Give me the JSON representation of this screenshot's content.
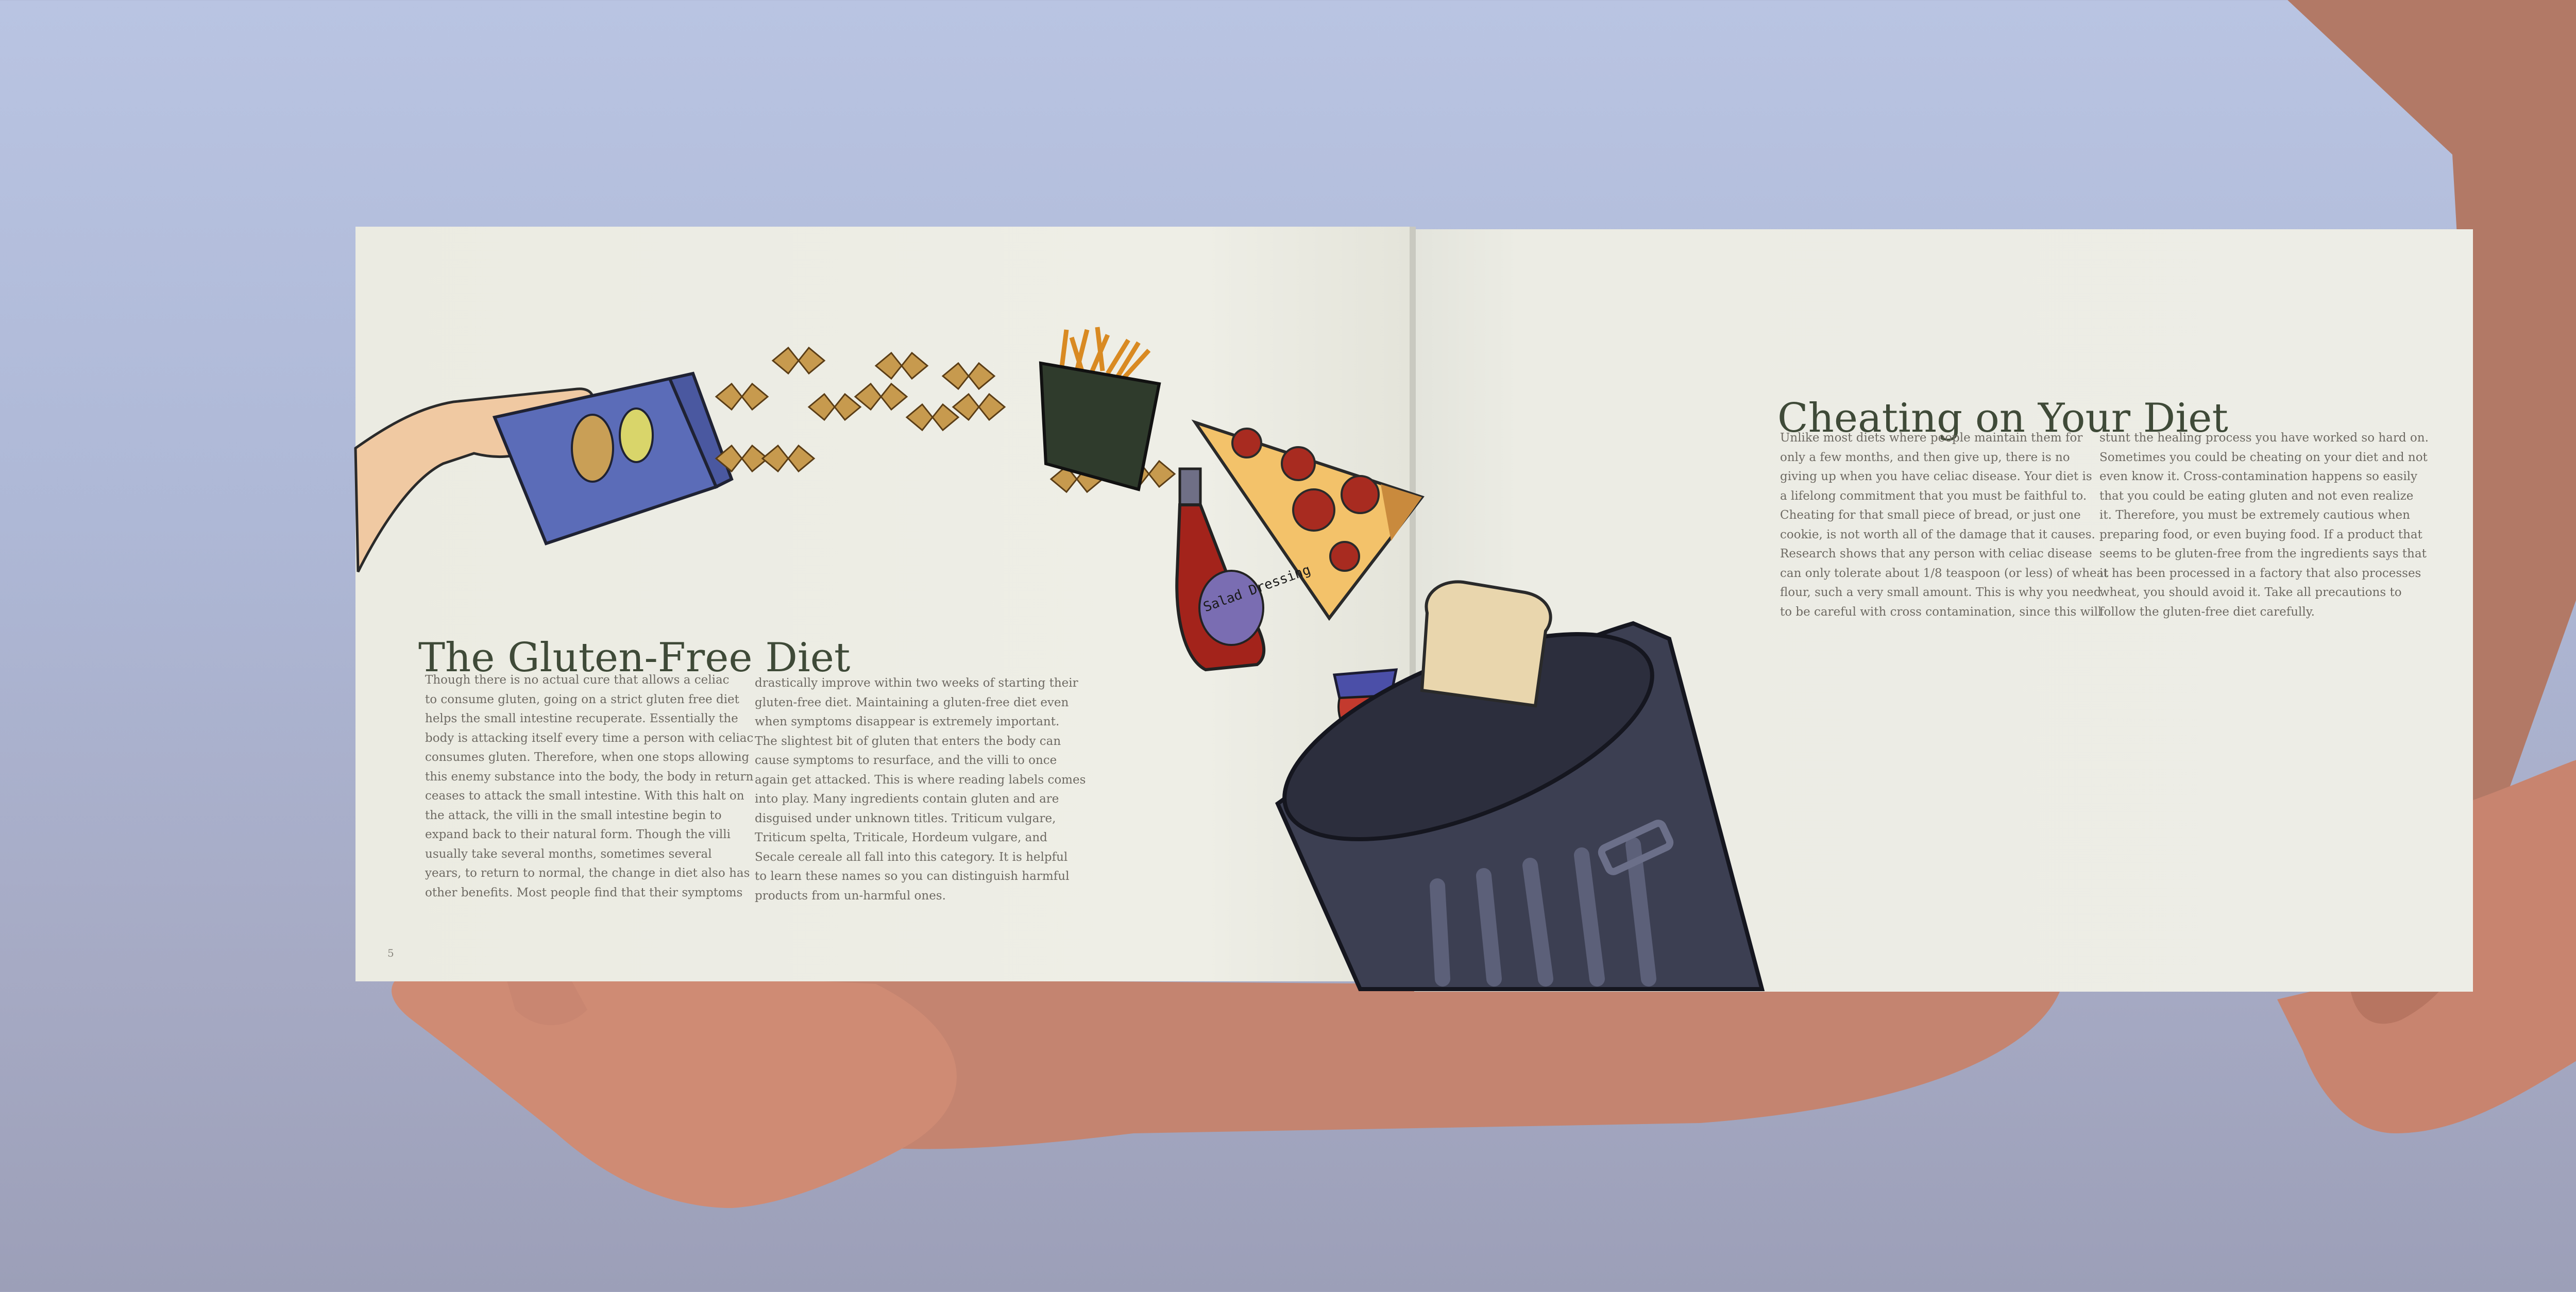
{
  "left_page": {
    "title": "The Gluten-Free Diet",
    "column1": [
      "Though there is no actual cure that allows a celiac",
      "to consume gluten, going on a strict gluten free diet",
      "helps the small intestine recuperate. Essentially the",
      "body is attacking itself every time a person with celiac",
      "consumes gluten. Therefore, when one stops allowing",
      "this enemy substance into the body, the body in return",
      "ceases to attack the small intestine. With this halt on",
      "the attack, the villi in the small intestine begin to",
      "expand back to their natural form. Though the villi",
      "usually take several months, sometimes several",
      "years, to return to normal, the change in diet also has",
      "other benefits. Most people find that their symptoms"
    ],
    "column2": [
      "drastically improve within two weeks of starting their",
      "gluten-free diet. Maintaining a gluten-free diet even",
      "when symptoms disappear is extremely important.",
      "The slightest bit of gluten that enters the body can",
      "cause symptoms to resurface, and the villi to once",
      "again get attacked. This is where reading labels comes",
      "into play. Many ingredients contain gluten and are",
      "disguised under unknown titles. Triticum vulgare,",
      "Triticum spelta, Triticale, Hordeum vulgare, and",
      "Secale cereale all fall into this category. It is helpful",
      "to learn these names so you can distinguish harmful",
      "products from un-harmful ones."
    ],
    "page_number": "5"
  },
  "right_page": {
    "title": "Cheating on Your Diet",
    "column1": [
      "Unlike most diets where people maintain them for",
      "only a few months, and then give up, there is no",
      "giving up when you have celiac disease. Your diet is",
      "a lifelong commitment that you must be faithful to.",
      "Cheating for that small piece of bread, or just one",
      "cookie, is not worth all of the damage that it causes.",
      "Research shows that any person with celiac disease",
      "can only tolerate about 1/8 teaspoon (or less) of wheat",
      "flour, such a very small amount. This is why you need",
      "to be careful with cross contamination, since this will"
    ],
    "column2": [
      "stunt the healing process you have worked so hard on.",
      "Sometimes you could be cheating on your diet and not",
      "even know it. Cross-contamination happens so easily",
      "that you could be eating gluten and not even realize",
      "it. Therefore, you must be extremely cautious when",
      "preparing food, or even buying food. If a product that",
      "seems to be gluten-free from the ingredients says that",
      "it has been processed in a factory that also processes",
      "wheat, you should avoid it. Take all precautions to",
      "follow the gluten-free diet carefully."
    ]
  },
  "illustration": {
    "bottle_label": "Salad Dressing",
    "icons": [
      "hand-icon",
      "pasta-box-icon",
      "bowtie-pasta-icon",
      "fries-icon",
      "salad-dressing-bottle-icon",
      "pizza-slice-icon",
      "cupcake-icon",
      "bread-slice-icon",
      "trash-can-icon"
    ]
  },
  "colors": {
    "page": "#ecece4",
    "title": "#3f4a38",
    "body_text": "#6e6a63",
    "background": "#b3bddb",
    "box_blue": "#5b6cb8",
    "pasta": "#c79a4e",
    "ketchup": "#a3231b",
    "trash_can": "#3c3f52"
  }
}
